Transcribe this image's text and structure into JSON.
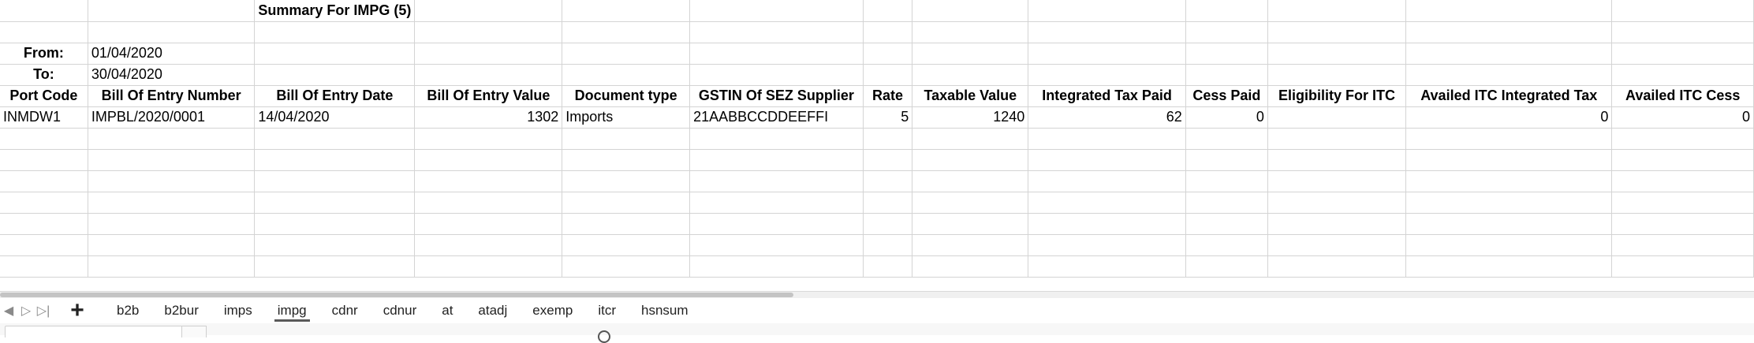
{
  "sheet": {
    "title": "Summary For IMPG (5)",
    "from_label": "From:",
    "from_value": "01/04/2020",
    "to_label": "To:",
    "to_value": "30/04/2020",
    "headers": [
      "Port Code",
      "Bill Of Entry Number",
      "Bill Of Entry Date",
      "Bill Of Entry Value",
      "Document type",
      "GSTIN Of SEZ Supplier",
      "Rate",
      "Taxable Value",
      "Integrated Tax Paid",
      "Cess Paid",
      "Eligibility For ITC",
      "Availed ITC Integrated Tax",
      "Availed ITC Cess"
    ],
    "rows": [
      [
        "INMDW1",
        "IMPBL/2020/0001",
        "14/04/2020",
        "1302",
        "Imports",
        "21AABBCCDDEEFFI",
        "5",
        "1240",
        "62",
        "0",
        "",
        "0",
        "0"
      ]
    ]
  },
  "tabs": {
    "items": [
      "b2b",
      "b2bur",
      "imps",
      "impg",
      "cdnr",
      "cdnur",
      "at",
      "atadj",
      "exemp",
      "itcr",
      "hsnsum"
    ],
    "active": "impg"
  },
  "icons": {
    "first": "chevron-first-icon",
    "prev": "chevron-left-icon",
    "next": "chevron-right-icon",
    "last": "chevron-last-icon",
    "add": "plus-icon"
  }
}
